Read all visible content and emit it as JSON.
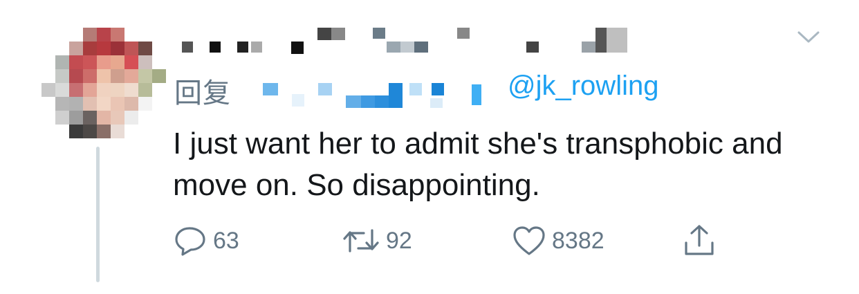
{
  "tweet": {
    "reply_prefix": "回复",
    "reply_handle": "@jk_rowling",
    "text": "I just want her to admit she's transphobic and move on. So disappointing.",
    "actions": {
      "reply_count": "63",
      "retweet_count": "92",
      "like_count": "8382"
    }
  },
  "icons": {
    "reply": "reply-icon",
    "retweet": "retweet-icon",
    "like": "heart-icon",
    "share": "share-icon",
    "menu": "chevron-down-icon"
  },
  "colors": {
    "text": "#14171a",
    "muted": "#657786",
    "link": "#1da1f2",
    "thread_line": "#cfd9de"
  }
}
